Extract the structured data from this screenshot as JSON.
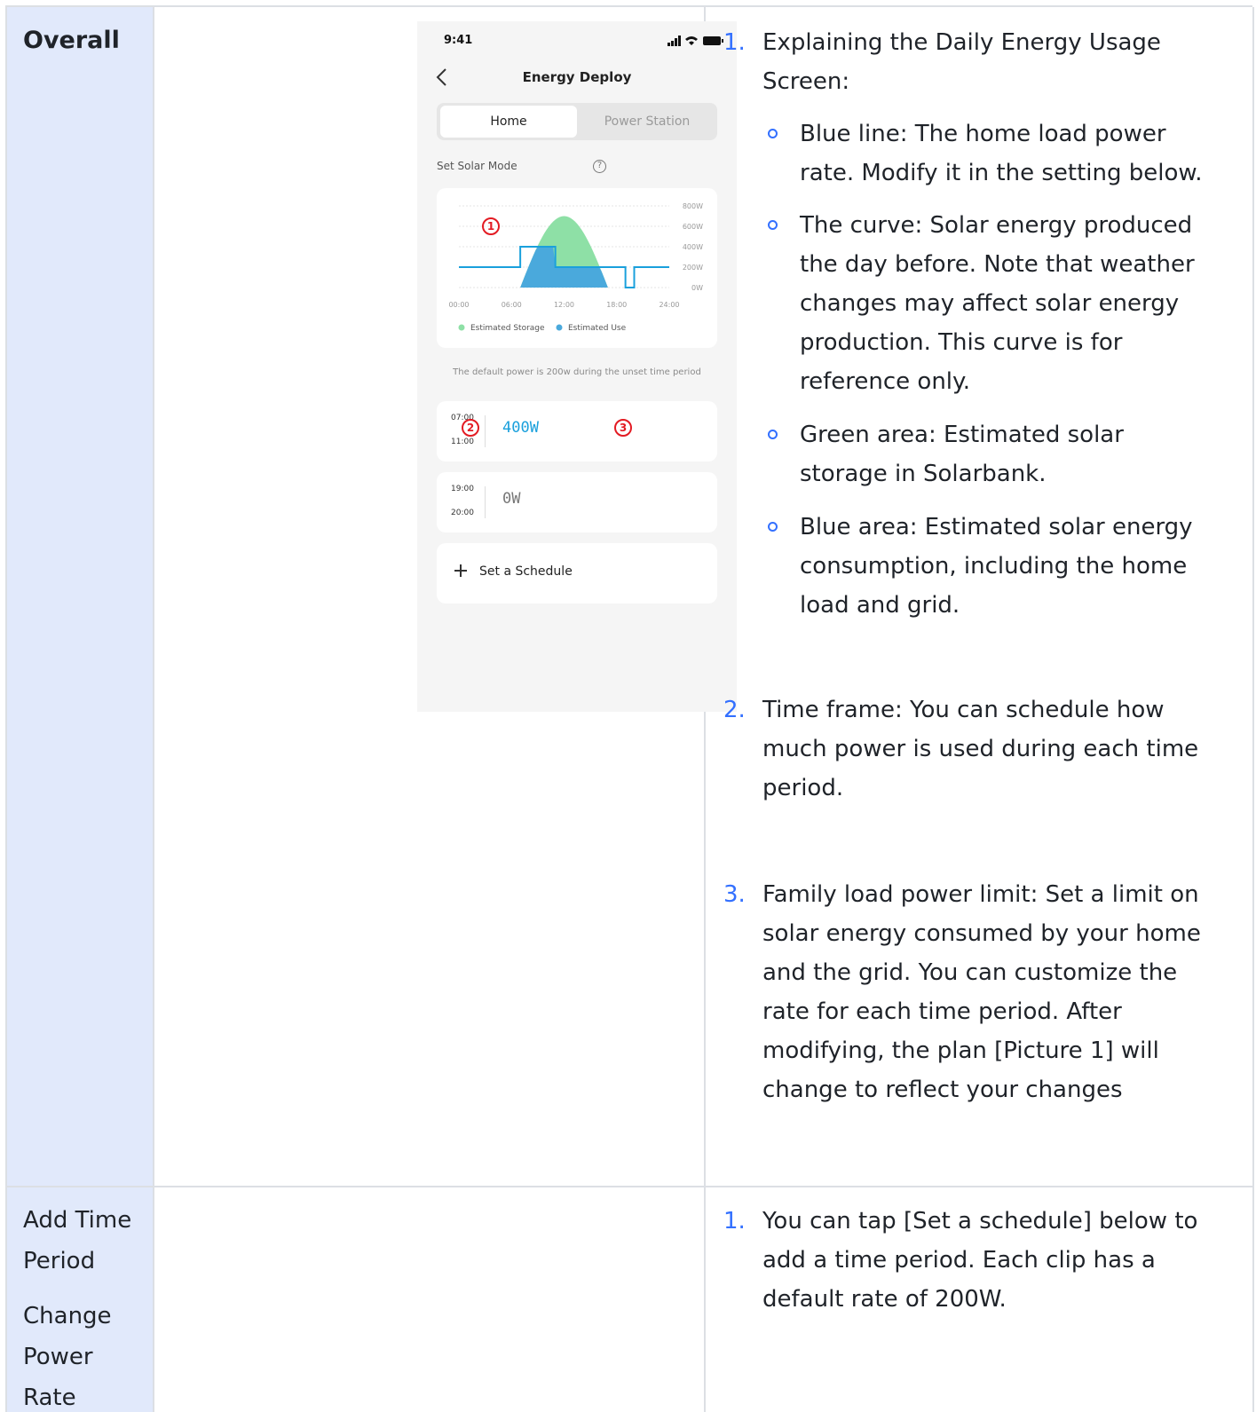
{
  "row1": {
    "heading": "Overall",
    "phone": {
      "status_time": "9:41",
      "title": "Energy Deploy",
      "tab_home": "Home",
      "tab_power_station": "Power Station",
      "set_solar_mode": "Set Solar Mode",
      "help": "?",
      "chart_data": {
        "type": "area",
        "x_ticks": [
          "00:00",
          "06:00",
          "12:00",
          "18:00",
          "24:00"
        ],
        "y_ticks": [
          "800W",
          "600W",
          "400W",
          "200W",
          "0W"
        ],
        "ylim": [
          0,
          800
        ],
        "xlim": [
          0,
          24
        ],
        "legend": [
          "Estimated Storage",
          "Estimated Use"
        ],
        "legend_position": "bottom",
        "series": [
          {
            "name": "Estimated Storage",
            "color": "#8ee0a6"
          },
          {
            "name": "Estimated Use",
            "color": "#4aa9dc"
          }
        ],
        "home_load_steps": [
          {
            "x": 0,
            "y": 200
          },
          {
            "x": 7,
            "y": 200
          },
          {
            "x": 7,
            "y": 400
          },
          {
            "x": 11,
            "y": 400
          },
          {
            "x": 11,
            "y": 200
          },
          {
            "x": 19,
            "y": 200
          },
          {
            "x": 19,
            "y": 0
          },
          {
            "x": 20,
            "y": 0
          },
          {
            "x": 20,
            "y": 200
          },
          {
            "x": 24,
            "y": 200
          }
        ]
      },
      "hint": "The default power is 200w during the unset time period",
      "period1": {
        "start": "07:00",
        "end": "11:00",
        "value": "400W"
      },
      "period2": {
        "start": "19:00",
        "end": "20:00",
        "value": "0W"
      },
      "schedule_label": "Set a Schedule",
      "markers": [
        "1",
        "2",
        "3"
      ]
    },
    "list": [
      {
        "num": "1.",
        "text": "Explaining the Daily Energy Usage Screen:",
        "bullets": [
          "Blue line: The home load power rate. Modify it in the setting below.",
          "The curve: Solar energy produced the day before. Note that weather changes may affect solar energy production. This curve is for reference only.",
          "Green area: Estimated solar storage in Solarbank.",
          "Blue area: Estimated solar energy consumption, including the home load and grid."
        ]
      },
      {
        "num": "2.",
        "text": "Time frame: You can schedule how much power is used during each time period."
      },
      {
        "num": "3.",
        "text": "Family load power limit: Set a limit on solar energy consumed by your home and the grid. You can customize the rate for each time period. After modifying, the plan [Picture 1] will change to reflect your changes"
      }
    ]
  },
  "row2": {
    "label_a": "Add Time Period",
    "label_b": "Change Power Rate",
    "list": [
      {
        "num": "1.",
        "text": "You can tap [Set a schedule] below to add a time period. Each clip has a default rate of 200W."
      }
    ]
  },
  "colors": {
    "accent": "#3370ff",
    "sidebar": "#e1e9fb",
    "value_blue": "#1aa0dc",
    "marker_red": "#e31b23"
  }
}
